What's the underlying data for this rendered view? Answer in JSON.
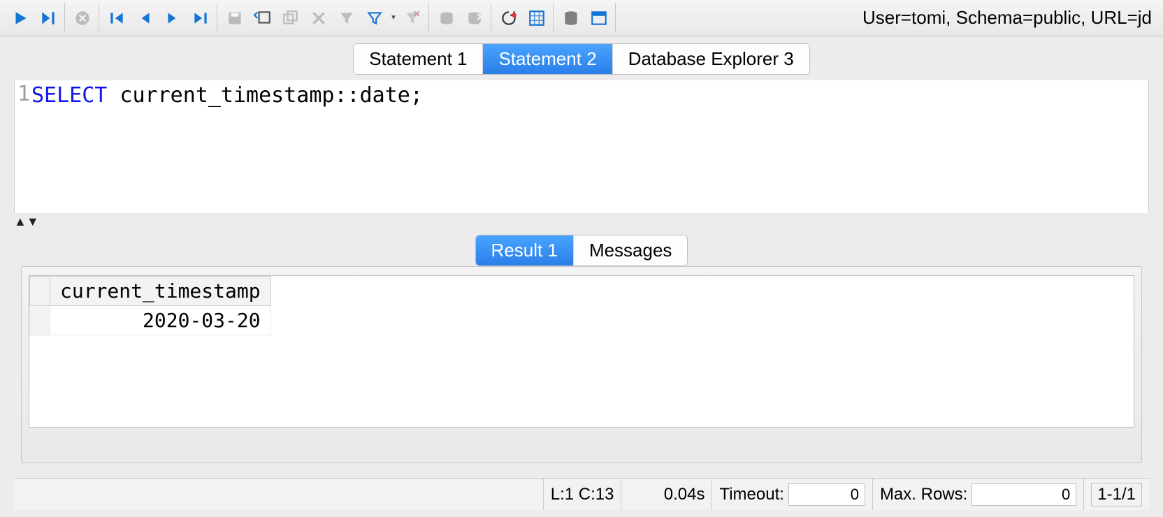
{
  "toolbar": {
    "connection_info": "User=tomi, Schema=public, URL=jd"
  },
  "tabs": {
    "items": [
      {
        "label": "Statement 1",
        "active": false
      },
      {
        "label": "Statement 2",
        "active": true
      },
      {
        "label": "Database Explorer 3",
        "active": false
      }
    ]
  },
  "editor": {
    "line_number": "1",
    "sql_keyword": "SELECT",
    "sql_rest": " current_timestamp::date;"
  },
  "result_tabs": {
    "items": [
      {
        "label": "Result 1",
        "active": true
      },
      {
        "label": "Messages",
        "active": false
      }
    ]
  },
  "result": {
    "columns": [
      "current_timestamp"
    ],
    "rows": [
      [
        "2020-03-20"
      ]
    ]
  },
  "statusbar": {
    "cursor": "L:1 C:13",
    "elapsed": "0.04s",
    "timeout_label": "Timeout:",
    "timeout_value": "0",
    "maxrows_label": "Max. Rows:",
    "maxrows_value": "0",
    "range": "1-1/1"
  }
}
